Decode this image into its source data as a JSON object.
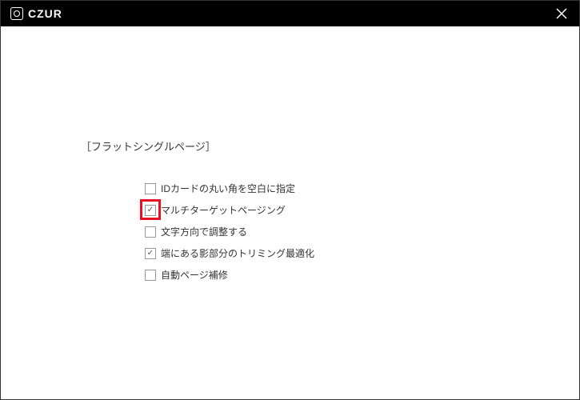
{
  "brand": {
    "name": "CZUR"
  },
  "section": {
    "title": "［フラットシングルページ］"
  },
  "options": [
    {
      "label": "IDカードの丸い角を空白に指定",
      "checked": false,
      "highlighted": false
    },
    {
      "label": "マルチターゲットページング",
      "checked": true,
      "highlighted": true
    },
    {
      "label": "文字方向で調整する",
      "checked": false,
      "highlighted": false
    },
    {
      "label": "端にある影部分のトリミング最適化",
      "checked": true,
      "highlighted": false
    },
    {
      "label": "自動ページ補修",
      "checked": false,
      "highlighted": false
    }
  ]
}
